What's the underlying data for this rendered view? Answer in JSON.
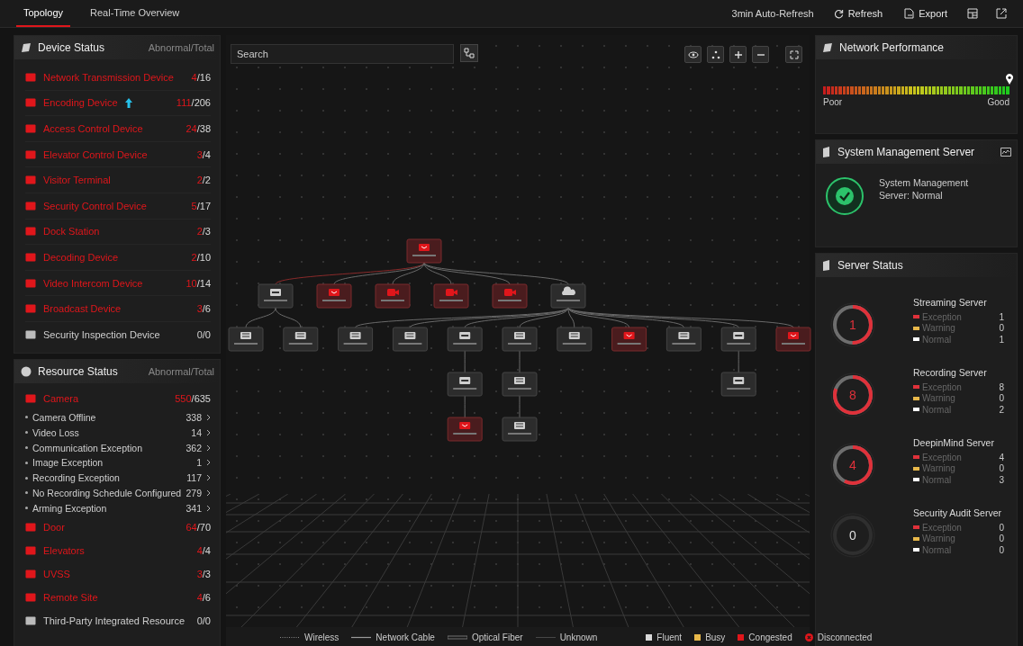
{
  "tabs": [
    {
      "label": "Topology",
      "selected": true
    },
    {
      "label": "Real-Time Overview",
      "selected": false
    }
  ],
  "toolbar": {
    "auto_refresh": "3min Auto-Refresh",
    "refresh": "Refresh",
    "export": "Export"
  },
  "device_status": {
    "title": "Device Status",
    "subtitle": "Abnormal/Total",
    "items": [
      {
        "name": "Network Transmission Device",
        "abnormal": "4",
        "total": "/16",
        "alert": true,
        "upgrade": false
      },
      {
        "name": "Encoding Device",
        "abnormal": "111",
        "total": "/206",
        "alert": true,
        "upgrade": true
      },
      {
        "name": "Access Control Device",
        "abnormal": "24",
        "total": "/38",
        "alert": true,
        "upgrade": false
      },
      {
        "name": "Elevator Control Device",
        "abnormal": "3",
        "total": "/4",
        "alert": true,
        "upgrade": false
      },
      {
        "name": "Visitor Terminal",
        "abnormal": "2",
        "total": "/2",
        "alert": true,
        "upgrade": false
      },
      {
        "name": "Security Control Device",
        "abnormal": "5",
        "total": "/17",
        "alert": true,
        "upgrade": false
      },
      {
        "name": "Dock Station",
        "abnormal": "2",
        "total": "/3",
        "alert": true,
        "upgrade": false
      },
      {
        "name": "Decoding Device",
        "abnormal": "2",
        "total": "/10",
        "alert": true,
        "upgrade": false
      },
      {
        "name": "Video Intercom Device",
        "abnormal": "10",
        "total": "/14",
        "alert": true,
        "upgrade": false
      },
      {
        "name": "Broadcast Device",
        "abnormal": "3",
        "total": "/6",
        "alert": true,
        "upgrade": false
      },
      {
        "name": "Security Inspection Device",
        "abnormal": "0",
        "total": "/0",
        "alert": false,
        "upgrade": false
      }
    ]
  },
  "resource_status": {
    "title": "Resource Status",
    "subtitle": "Abnormal/Total",
    "items": [
      {
        "name": "Camera",
        "abnormal": "550",
        "total": "/635",
        "alert": true,
        "details": [
          {
            "label": "Camera Offline",
            "count": "338"
          },
          {
            "label": "Video Loss",
            "count": "14"
          },
          {
            "label": "Communication Exception",
            "count": "362"
          },
          {
            "label": "Image Exception",
            "count": "1"
          },
          {
            "label": "Recording Exception",
            "count": "117"
          },
          {
            "label": "No Recording Schedule Configured",
            "count": "279"
          },
          {
            "label": "Arming Exception",
            "count": "341"
          }
        ]
      },
      {
        "name": "Door",
        "abnormal": "64",
        "total": "/70",
        "alert": true
      },
      {
        "name": "Elevators",
        "abnormal": "4",
        "total": "/4",
        "alert": true
      },
      {
        "name": "UVSS",
        "abnormal": "3",
        "total": "/3",
        "alert": true
      },
      {
        "name": "Remote Site",
        "abnormal": "4",
        "total": "/6",
        "alert": true
      },
      {
        "name": "Third-Party Integrated Resource",
        "abnormal": "0",
        "total": "/0",
        "alert": false
      }
    ]
  },
  "search": {
    "placeholder": "Search"
  },
  "topology": {
    "kind": "encoder",
    "alert": true,
    "children": [
      {
        "kind": "switch",
        "alert": false,
        "children": [
          {
            "kind": "nvr",
            "alert": false
          },
          {
            "kind": "nvr",
            "alert": false
          }
        ]
      },
      {
        "kind": "encoder",
        "alert": true
      },
      {
        "kind": "camera",
        "alert": true
      },
      {
        "kind": "camera",
        "alert": true
      },
      {
        "kind": "camera",
        "alert": true
      },
      {
        "kind": "cloud",
        "alert": false,
        "children": [
          {
            "kind": "nvr",
            "alert": false
          },
          {
            "kind": "nvr",
            "alert": false
          },
          {
            "kind": "switch",
            "alert": false,
            "children": [
              {
                "kind": "switch",
                "alert": false,
                "children": [
                  {
                    "kind": "encoder",
                    "alert": true
                  }
                ]
              }
            ]
          },
          {
            "kind": "nvr",
            "alert": false,
            "children": [
              {
                "kind": "nvr",
                "alert": false,
                "children": [
                  {
                    "kind": "nvr",
                    "alert": false
                  }
                ]
              }
            ]
          },
          {
            "kind": "nvr",
            "alert": false
          },
          {
            "kind": "encoder",
            "alert": true
          },
          {
            "kind": "nvr",
            "alert": false
          },
          {
            "kind": "switch",
            "alert": false,
            "children": [
              {
                "kind": "switch",
                "alert": false
              }
            ]
          },
          {
            "kind": "encoder",
            "alert": true
          }
        ]
      }
    ]
  },
  "legend": {
    "links": [
      {
        "label": "Wireless",
        "kind": "dotted"
      },
      {
        "label": "Network Cable",
        "kind": "solid"
      },
      {
        "label": "Optical Fiber",
        "kind": "double"
      },
      {
        "label": "Unknown",
        "kind": "thin"
      }
    ],
    "states": [
      {
        "label": "Fluent",
        "color": "#d9d9d9",
        "kind": "square"
      },
      {
        "label": "Busy",
        "color": "#e8b84a",
        "kind": "square"
      },
      {
        "label": "Congested",
        "color": "#e0161b",
        "kind": "square"
      },
      {
        "label": "Disconnected",
        "color": "#e0161b",
        "kind": "cross"
      }
    ]
  },
  "network_performance": {
    "title": "Network Performance",
    "level": 1,
    "low": "Poor",
    "high": "Good"
  },
  "system_server": {
    "title": "System Management Server",
    "normal": true,
    "text": "System Management Server: Normal"
  },
  "server_status": {
    "title": "Server Status",
    "servers": [
      {
        "name": "Streaming Server",
        "count": "1",
        "rows": [
          {
            "label": "Exception",
            "value": "1",
            "color": "#e0313a"
          },
          {
            "label": "Warning",
            "value": "0",
            "color": "#e8b84a"
          },
          {
            "label": "Normal",
            "value": "1",
            "color": "#ffffff"
          }
        ]
      },
      {
        "name": "Recording Server",
        "count": "8",
        "rows": [
          {
            "label": "Exception",
            "value": "8",
            "color": "#e0313a"
          },
          {
            "label": "Warning",
            "value": "0",
            "color": "#e8b84a"
          },
          {
            "label": "Normal",
            "value": "2",
            "color": "#ffffff"
          }
        ]
      },
      {
        "name": "DeepinMind Server",
        "count": "4",
        "rows": [
          {
            "label": "Exception",
            "value": "4",
            "color": "#e0313a"
          },
          {
            "label": "Warning",
            "value": "0",
            "color": "#e8b84a"
          },
          {
            "label": "Normal",
            "value": "3",
            "color": "#ffffff"
          }
        ]
      },
      {
        "name": "Security Audit Server",
        "count": "0",
        "rows": [
          {
            "label": "Exception",
            "value": "0",
            "color": "#e0313a"
          },
          {
            "label": "Warning",
            "value": "0",
            "color": "#e8b84a"
          },
          {
            "label": "Normal",
            "value": "0",
            "color": "#ffffff"
          }
        ]
      }
    ]
  }
}
